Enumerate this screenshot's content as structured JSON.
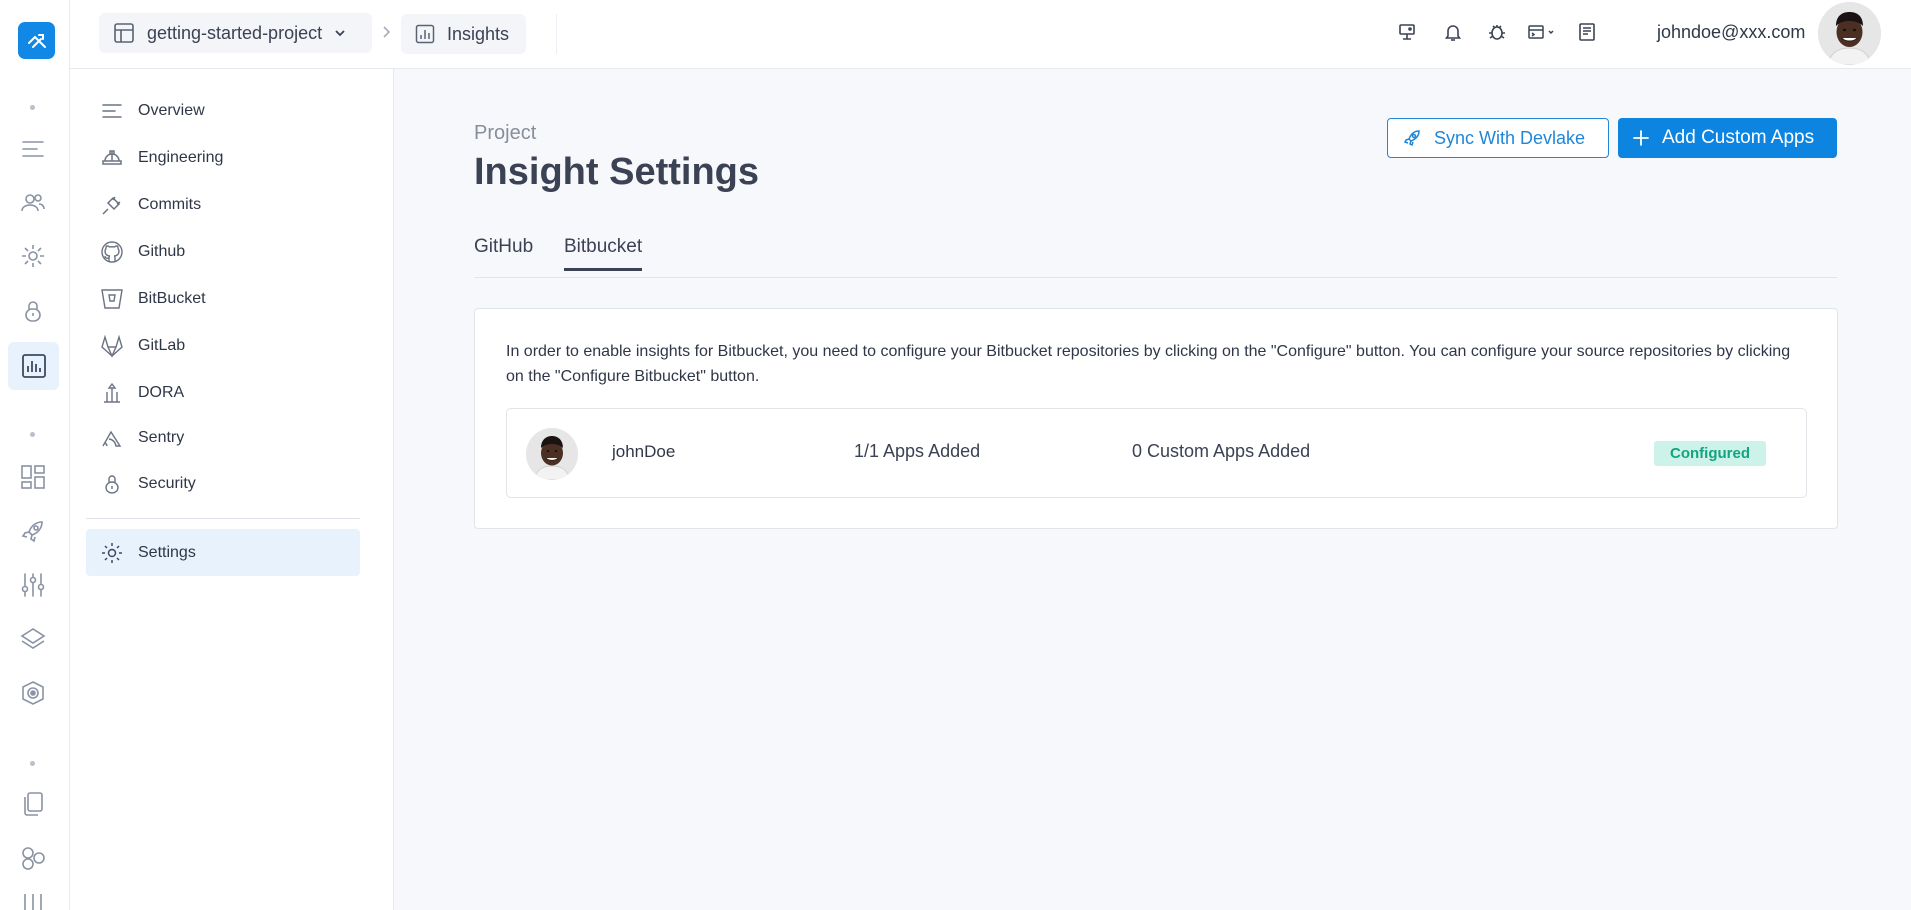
{
  "breadcrumb": {
    "project_name": "getting-started-project",
    "section": "Insights"
  },
  "user": {
    "email": "johndoe@xxx.com"
  },
  "sidebar": {
    "items": [
      {
        "label": "Overview",
        "icon": "lines-icon"
      },
      {
        "label": "Engineering",
        "icon": "helmet-icon"
      },
      {
        "label": "Commits",
        "icon": "plug-icon"
      },
      {
        "label": "Github",
        "icon": "github-icon"
      },
      {
        "label": "BitBucket",
        "icon": "bitbucket-icon"
      },
      {
        "label": "GitLab",
        "icon": "gitlab-icon"
      },
      {
        "label": "DORA",
        "icon": "bank-icon"
      },
      {
        "label": "Sentry",
        "icon": "sentry-icon"
      },
      {
        "label": "Security",
        "icon": "lock-icon"
      }
    ],
    "settings_label": "Settings"
  },
  "main": {
    "eyebrow": "Project",
    "title": "Insight Settings",
    "sync_button": "Sync With Devlake",
    "add_button": "Add Custom Apps",
    "tabs": [
      {
        "label": "GitHub",
        "active": false
      },
      {
        "label": "Bitbucket",
        "active": true
      }
    ],
    "description": "In order to enable insights for Bitbucket, you need to configure your Bitbucket repositories by clicking on the \"Configure\" button. You can configure your source repositories by clicking on the \"Configure Bitbucket\" button.",
    "row": {
      "username": "johnDoe",
      "apps_added": "1/1 Apps Added",
      "custom_apps_added": "0 Custom Apps Added",
      "status": "Configured"
    }
  },
  "colors": {
    "primary": "#0d84e0",
    "badge_bg": "#cdf2ea",
    "badge_text": "#13a47f"
  }
}
